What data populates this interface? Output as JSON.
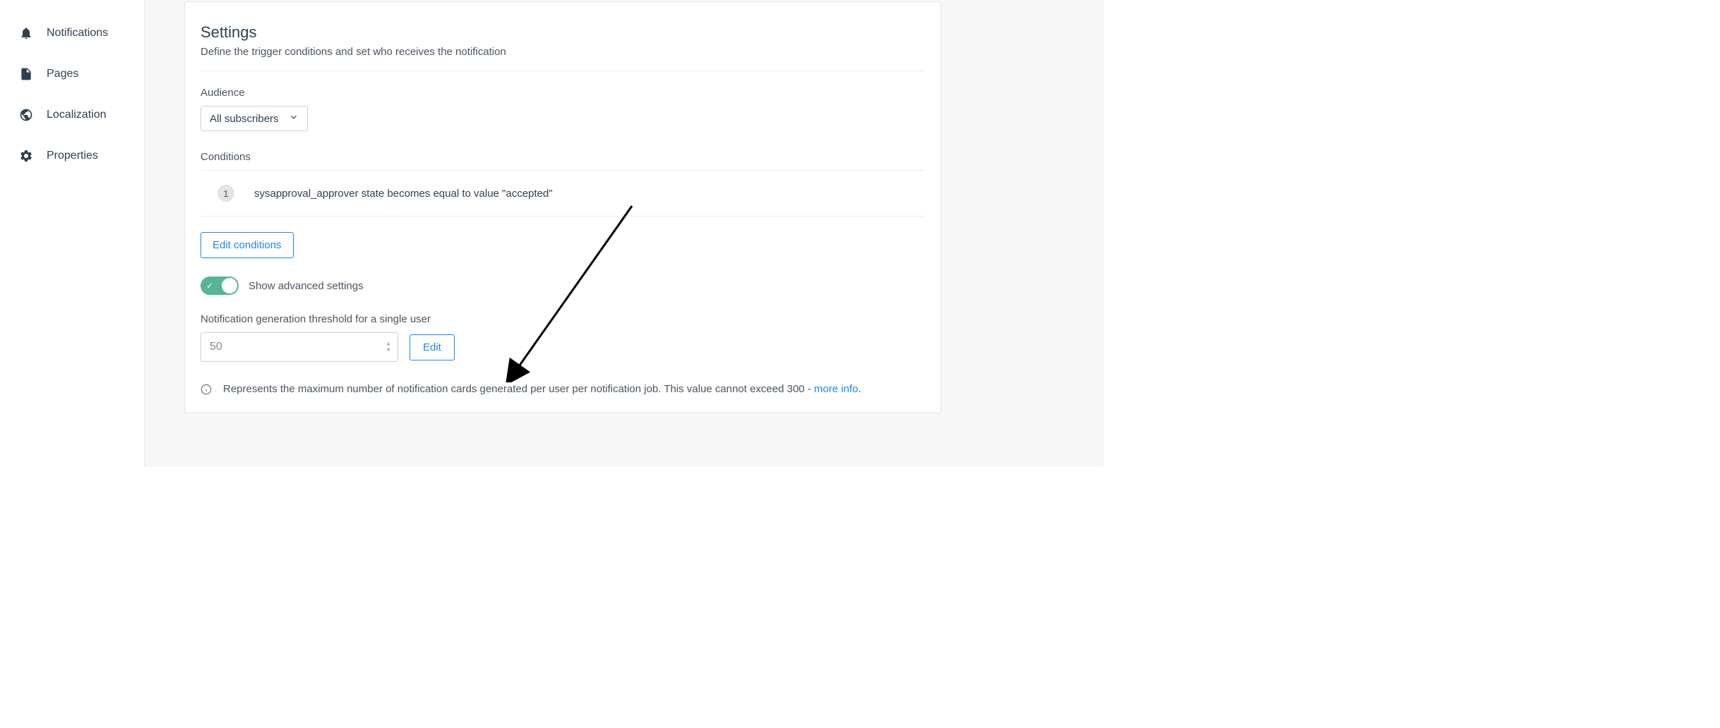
{
  "sidebar": {
    "items": [
      {
        "label": "Notifications",
        "icon": "bell"
      },
      {
        "label": "Pages",
        "icon": "file"
      },
      {
        "label": "Localization",
        "icon": "globe"
      },
      {
        "label": "Properties",
        "icon": "gear"
      }
    ]
  },
  "panel": {
    "title": "Settings",
    "subtitle": "Define the trigger conditions and set who receives the notification",
    "audience": {
      "label": "Audience",
      "selected": "All subscribers"
    },
    "conditions": {
      "label": "Conditions",
      "items": [
        {
          "index": "1",
          "text": "sysapproval_approver state becomes equal to value \"accepted\""
        }
      ],
      "edit_label": "Edit conditions"
    },
    "advanced_toggle": {
      "label": "Show advanced settings",
      "on": true
    },
    "threshold": {
      "label": "Notification generation threshold for a single user",
      "value": "50",
      "edit_label": "Edit"
    },
    "help": {
      "text_prefix": "Represents the maximum number of notification cards generated per user per notification job. This value cannot exceed 300 - ",
      "link_text": "more info",
      "period": "."
    }
  }
}
